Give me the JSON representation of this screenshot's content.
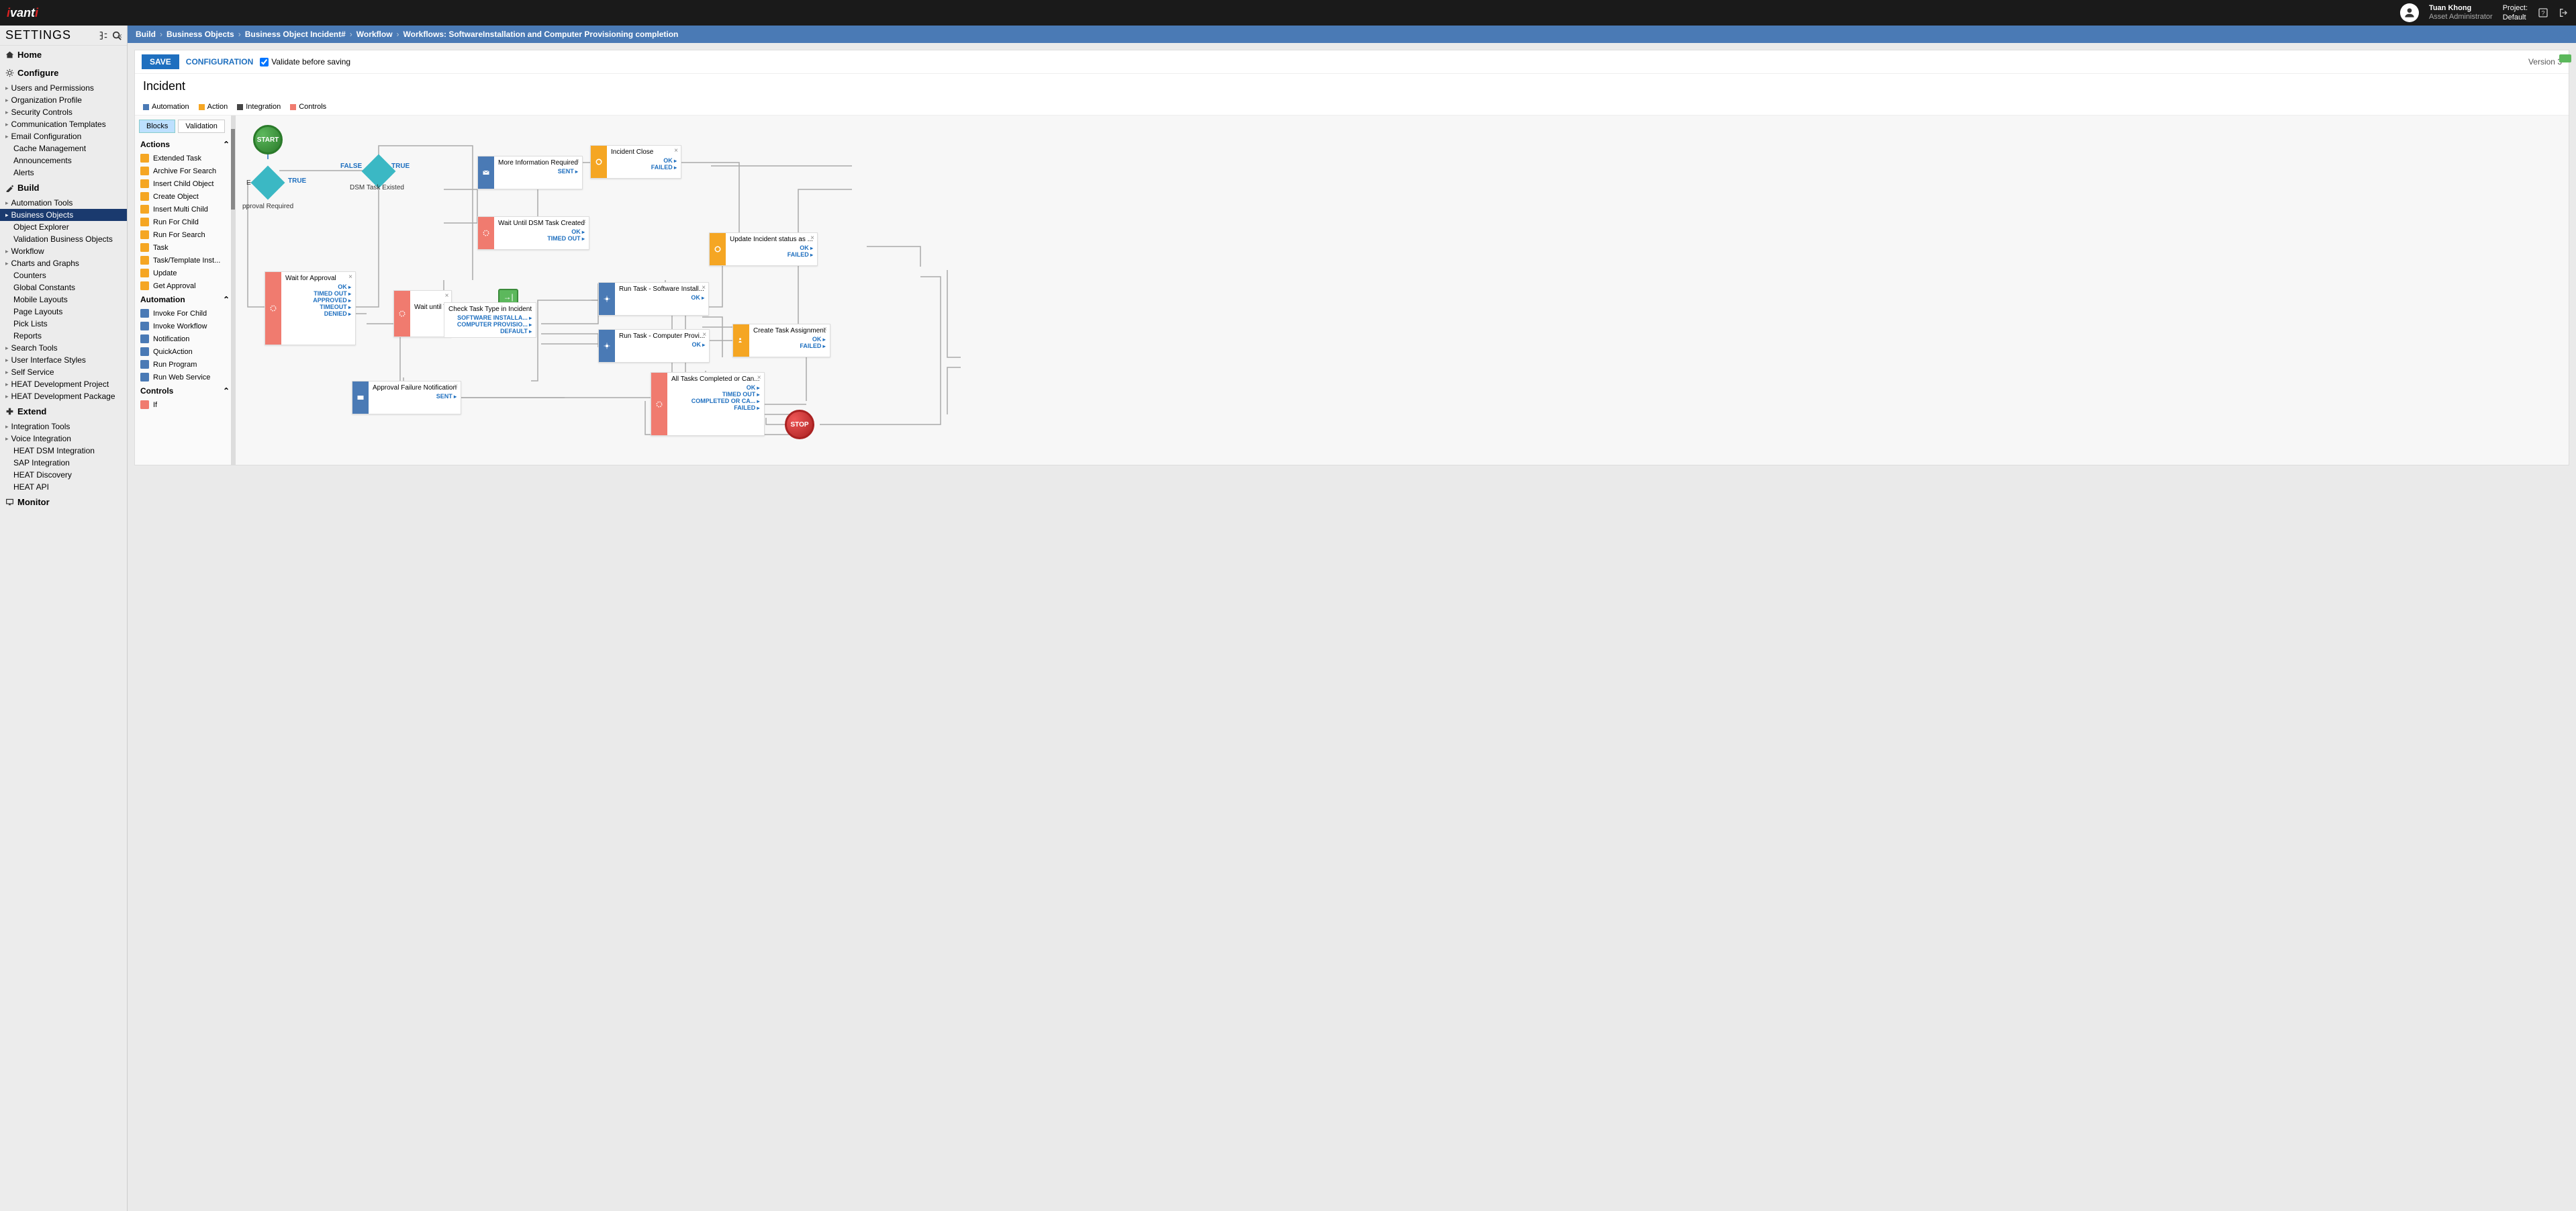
{
  "header": {
    "logo": "ivanti",
    "user": {
      "name": "Tuan Khong",
      "role": "Asset Administrator"
    },
    "project": {
      "label": "Project:",
      "value": "Default"
    }
  },
  "sidebar": {
    "title": "SETTINGS",
    "sections": [
      {
        "icon": "home",
        "label": "Home"
      },
      {
        "icon": "gear",
        "label": "Configure"
      }
    ],
    "configure_items": [
      {
        "label": "Users and Permissions",
        "exp": true
      },
      {
        "label": "Organization Profile",
        "exp": true
      },
      {
        "label": "Security Controls",
        "exp": true
      },
      {
        "label": "Communication Templates",
        "exp": true
      },
      {
        "label": "Email Configuration",
        "exp": true
      },
      {
        "label": "Cache Management"
      },
      {
        "label": "Announcements"
      },
      {
        "label": "Alerts"
      }
    ],
    "build": {
      "label": "Build"
    },
    "build_items": [
      {
        "label": "Automation Tools",
        "exp": true
      },
      {
        "label": "Business Objects",
        "exp": true,
        "active": true
      },
      {
        "label": "Object Explorer"
      },
      {
        "label": "Validation Business Objects"
      },
      {
        "label": "Workflow",
        "exp": true
      },
      {
        "label": "Charts and Graphs",
        "exp": true
      },
      {
        "label": "Counters"
      },
      {
        "label": "Global Constants"
      },
      {
        "label": "Mobile Layouts"
      },
      {
        "label": "Page Layouts"
      },
      {
        "label": "Pick Lists"
      },
      {
        "label": "Reports"
      },
      {
        "label": "Search Tools",
        "exp": true
      },
      {
        "label": "User Interface Styles",
        "exp": true
      },
      {
        "label": "Self Service",
        "exp": true
      },
      {
        "label": "HEAT Development Project",
        "exp": true
      },
      {
        "label": "HEAT Development Package",
        "exp": true
      }
    ],
    "extend": {
      "label": "Extend"
    },
    "extend_items": [
      {
        "label": "Integration Tools",
        "exp": true
      },
      {
        "label": "Voice Integration",
        "exp": true
      },
      {
        "label": "HEAT DSM Integration"
      },
      {
        "label": "SAP Integration"
      },
      {
        "label": "HEAT Discovery"
      },
      {
        "label": "HEAT API"
      }
    ],
    "monitor": {
      "label": "Monitor"
    }
  },
  "breadcrumb": {
    "items": [
      "Build",
      "Business Objects",
      "Business Object Incident#",
      "Workflow"
    ],
    "current": "Workflows: SoftwareInstallation and Computer Provisioning completion"
  },
  "toolbar": {
    "save": "SAVE",
    "config": "CONFIGURATION",
    "validate": "Validate before saving",
    "version": "Version 3"
  },
  "page": {
    "title": "Incident"
  },
  "legend": {
    "auto": "Automation",
    "action": "Action",
    "integ": "Integration",
    "ctrl": "Controls"
  },
  "palette": {
    "tabs": {
      "blocks": "Blocks",
      "validation": "Validation"
    },
    "groups": {
      "actions": "Actions",
      "automation": "Automation",
      "controls": "Controls"
    },
    "actions": [
      "Extended Task",
      "Archive For Search",
      "Insert Child Object",
      "Create Object",
      "Insert Multi Child",
      "Run For Child",
      "Run For Search",
      "Task",
      "Task/Template Inst...",
      "Update",
      "Get Approval"
    ],
    "automation": [
      "Invoke For Child",
      "Invoke Workflow",
      "Notification",
      "QuickAction",
      "Run Program",
      "Run Web Service"
    ],
    "controls": [
      "If"
    ]
  },
  "canvas": {
    "start": "START",
    "stop": "STOP",
    "labels": {
      "false": "FALSE",
      "true": "TRUE",
      "true2": "TRUE",
      "approval_req": "pproval Required",
      "dsm_existed": "DSM Task Existed",
      "e": "E"
    },
    "blocks": {
      "more_info": {
        "title": "More Information Required",
        "outs": [
          "SENT"
        ]
      },
      "incident_close": {
        "title": "Incident Close",
        "outs": [
          "OK",
          "FAILED"
        ]
      },
      "wait_dsm": {
        "title": "Wait Until DSM Task Created",
        "outs": [
          "OK",
          "TIMED OUT"
        ]
      },
      "update_status": {
        "title": "Update Incident status as ...",
        "outs": [
          "OK",
          "FAILED"
        ]
      },
      "wait_approval": {
        "title": "Wait for Approval",
        "outs": [
          "OK",
          "TIMED OUT",
          "APPROVED",
          "TIMEOUT",
          "DENIED"
        ]
      },
      "wait_until": {
        "title": "Wait until T"
      },
      "check_task": {
        "title": "Check Task Type in Incident",
        "outs": [
          "SOFTWARE INSTALLA...",
          "COMPUTER PROVISIO...",
          "DEFAULT"
        ]
      },
      "run_sw": {
        "title": "Run Task - Software Install...",
        "outs": [
          "OK"
        ]
      },
      "run_cp": {
        "title": "Run Task - Computer Provi...",
        "outs": [
          "OK"
        ]
      },
      "create_assign": {
        "title": "Create Task Assignment",
        "outs": [
          "OK",
          "FAILED"
        ]
      },
      "approval_fail": {
        "title": "Approval Failure Notification",
        "outs": [
          "SENT"
        ]
      },
      "all_tasks": {
        "title": "All Tasks Completed or Can...",
        "outs": [
          "OK",
          "TIMED OUT",
          "COMPLETED OR CA...",
          "FAILED"
        ]
      }
    }
  }
}
